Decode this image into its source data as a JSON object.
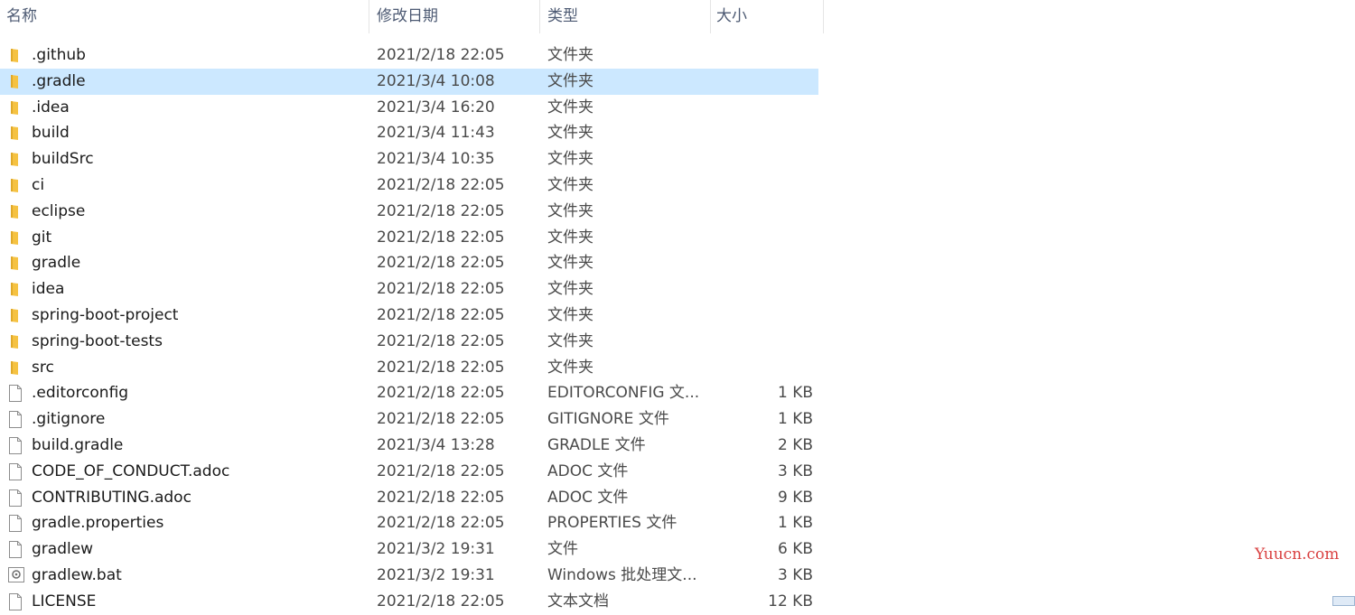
{
  "columns": {
    "name": "名称",
    "date": "修改日期",
    "type": "类型",
    "size": "大小"
  },
  "sort_indicator": "^",
  "files": [
    {
      "name": ".github",
      "date": "2021/2/18 22:05",
      "type": "文件夹",
      "size": "",
      "icon": "folder-icon"
    },
    {
      "name": ".gradle",
      "date": "2021/3/4 10:08",
      "type": "文件夹",
      "size": "",
      "icon": "folder-icon",
      "selected": true
    },
    {
      "name": ".idea",
      "date": "2021/3/4 16:20",
      "type": "文件夹",
      "size": "",
      "icon": "folder-icon"
    },
    {
      "name": "build",
      "date": "2021/3/4 11:43",
      "type": "文件夹",
      "size": "",
      "icon": "folder-icon"
    },
    {
      "name": "buildSrc",
      "date": "2021/3/4 10:35",
      "type": "文件夹",
      "size": "",
      "icon": "folder-icon"
    },
    {
      "name": "ci",
      "date": "2021/2/18 22:05",
      "type": "文件夹",
      "size": "",
      "icon": "folder-icon"
    },
    {
      "name": "eclipse",
      "date": "2021/2/18 22:05",
      "type": "文件夹",
      "size": "",
      "icon": "folder-icon"
    },
    {
      "name": "git",
      "date": "2021/2/18 22:05",
      "type": "文件夹",
      "size": "",
      "icon": "folder-icon"
    },
    {
      "name": "gradle",
      "date": "2021/2/18 22:05",
      "type": "文件夹",
      "size": "",
      "icon": "folder-icon"
    },
    {
      "name": "idea",
      "date": "2021/2/18 22:05",
      "type": "文件夹",
      "size": "",
      "icon": "folder-icon"
    },
    {
      "name": "spring-boot-project",
      "date": "2021/2/18 22:05",
      "type": "文件夹",
      "size": "",
      "icon": "folder-icon"
    },
    {
      "name": "spring-boot-tests",
      "date": "2021/2/18 22:05",
      "type": "文件夹",
      "size": "",
      "icon": "folder-icon"
    },
    {
      "name": "src",
      "date": "2021/2/18 22:05",
      "type": "文件夹",
      "size": "",
      "icon": "folder-icon"
    },
    {
      "name": ".editorconfig",
      "date": "2021/2/18 22:05",
      "type": "EDITORCONFIG 文...",
      "size": "1 KB",
      "icon": "file-icon"
    },
    {
      "name": ".gitignore",
      "date": "2021/2/18 22:05",
      "type": "GITIGNORE 文件",
      "size": "1 KB",
      "icon": "file-icon"
    },
    {
      "name": "build.gradle",
      "date": "2021/3/4 13:28",
      "type": "GRADLE 文件",
      "size": "2 KB",
      "icon": "file-icon"
    },
    {
      "name": "CODE_OF_CONDUCT.adoc",
      "date": "2021/2/18 22:05",
      "type": "ADOC 文件",
      "size": "3 KB",
      "icon": "file-icon"
    },
    {
      "name": "CONTRIBUTING.adoc",
      "date": "2021/2/18 22:05",
      "type": "ADOC 文件",
      "size": "9 KB",
      "icon": "file-icon"
    },
    {
      "name": "gradle.properties",
      "date": "2021/2/18 22:05",
      "type": "PROPERTIES 文件",
      "size": "1 KB",
      "icon": "file-icon"
    },
    {
      "name": "gradlew",
      "date": "2021/3/2 19:31",
      "type": "文件",
      "size": "6 KB",
      "icon": "file-icon"
    },
    {
      "name": "gradlew.bat",
      "date": "2021/3/2 19:31",
      "type": "Windows 批处理文...",
      "size": "3 KB",
      "icon": "batch-file-icon"
    },
    {
      "name": "LICENSE",
      "date": "2021/2/18 22:05",
      "type": "文本文档",
      "size": "12 KB",
      "icon": "text-file-icon"
    }
  ],
  "watermark": "Yuucn.com",
  "colors": {
    "selection": "#cce8ff",
    "folder": "#f5c242",
    "watermark": "#d94040"
  }
}
